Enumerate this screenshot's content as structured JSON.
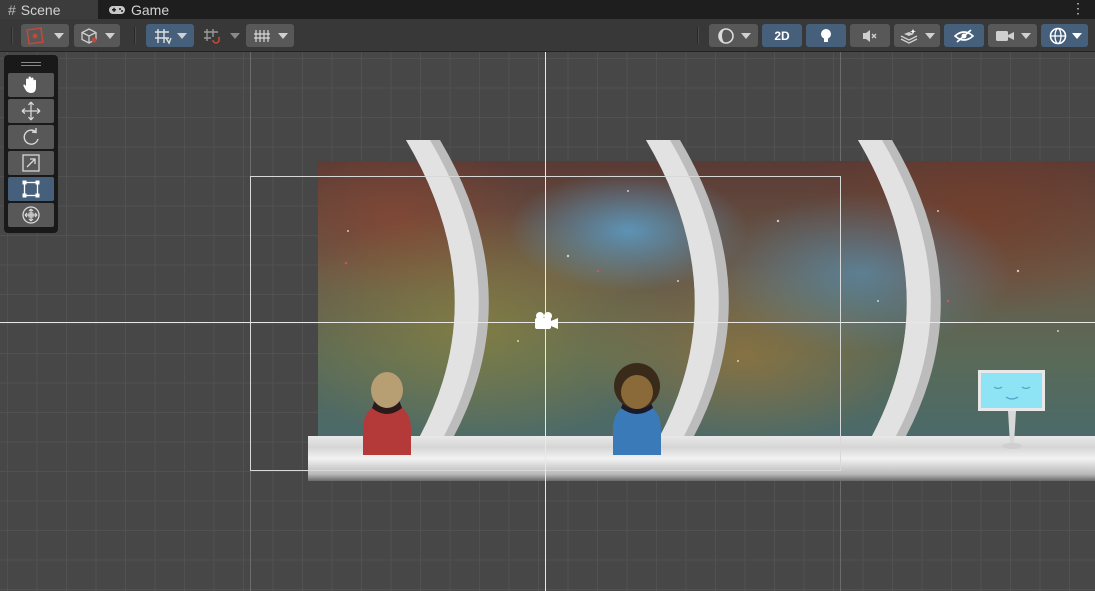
{
  "tabs": {
    "scene": "Scene",
    "game": "Game",
    "scene_icon": "hash-icon",
    "game_icon": "gamepad-icon",
    "menu": "⋮"
  },
  "toolbar": {
    "mode_2d_label": "2D",
    "left_group": [
      "draw-mode-icon",
      "orientation-cube-icon",
      "grid-snap-icon",
      "increment-snap-icon",
      "grid-visibility-icon"
    ],
    "right_group": [
      "shading-sphere-icon",
      "2d-toggle",
      "lighting-bulb-icon",
      "audio-mute-icon",
      "effects-layers-icon",
      "scene-visibility-icon",
      "camera-icon",
      "gizmos-icon"
    ]
  },
  "tools": [
    "hand-tool-icon",
    "move-tool-icon",
    "rotate-tool-icon",
    "scale-tool-icon",
    "rect-tool-icon",
    "transform-tool-icon"
  ],
  "active_tool": "rect-tool-icon",
  "colors": {
    "accent": "#46607c",
    "panel": "#383838",
    "viewport": "#474747",
    "red_character": "#b43a3a",
    "blue_character": "#3a7ab8",
    "screen": "#8ee4f4"
  }
}
